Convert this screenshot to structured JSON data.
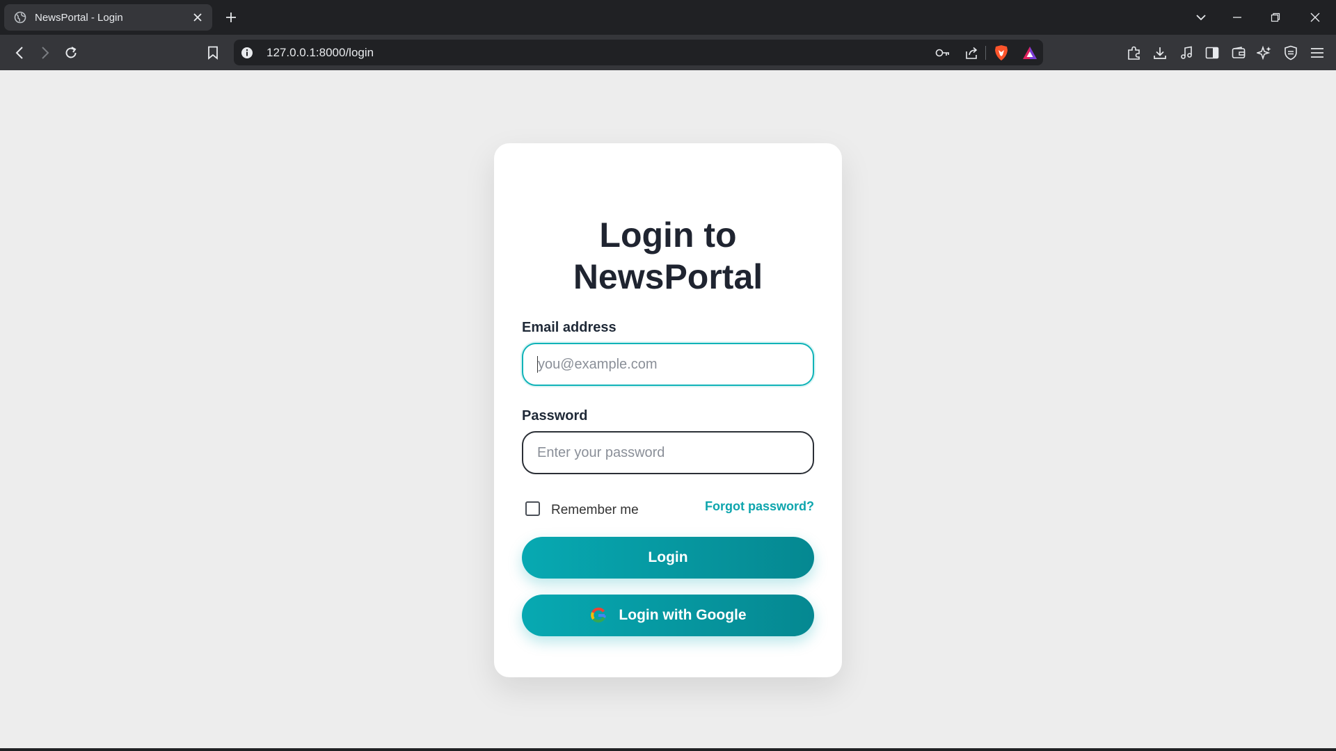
{
  "browser": {
    "tab_title": "NewsPortal - Login",
    "url": "127.0.0.1:8000/login",
    "icons": [
      "globe-icon",
      "close-icon",
      "plus-icon",
      "chevron-down-icon",
      "minimize-icon",
      "restore-icon",
      "window-close-icon",
      "back-icon",
      "forward-icon",
      "reload-icon",
      "bookmark-icon",
      "info-icon",
      "key-icon",
      "share-icon",
      "brave-shield-icon",
      "brave-rewards-icon",
      "extensions-icon",
      "download-icon",
      "media-icon",
      "sidebar-icon",
      "wallet-icon",
      "leo-icon",
      "vpn-icon",
      "menu-icon"
    ]
  },
  "login": {
    "title_line1": "Login to",
    "title_line2": "NewsPortal",
    "email_label": "Email address",
    "email_placeholder": "you@example.com",
    "email_value": "",
    "password_label": "Password",
    "password_placeholder": "Enter your password",
    "password_value": "",
    "remember_label": "Remember me",
    "remember_checked": false,
    "forgot_label": "Forgot password?",
    "login_button": "Login",
    "google_button": "Login with Google"
  },
  "colors": {
    "accent": "#07a9b2",
    "page_bg": "#ededed",
    "card_bg": "#ffffff",
    "title_text": "#1f2430",
    "chrome_dark": "#202124",
    "chrome_toolbar": "#35363a"
  }
}
